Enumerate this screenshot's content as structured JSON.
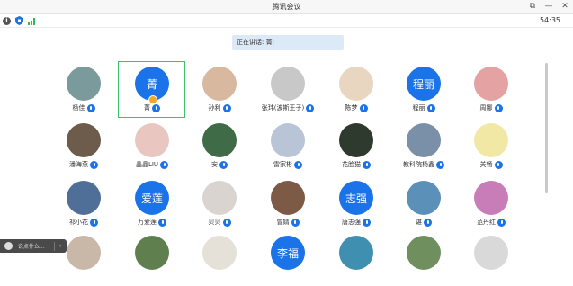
{
  "window": {
    "title": "腾讯会议"
  },
  "status": {
    "timer": "54:35"
  },
  "banner": {
    "text": "正在讲话: 菁;"
  },
  "participants": [
    {
      "name": "杨佳",
      "avatar_text": "",
      "color": "#7a9a9c"
    },
    {
      "name": "菁",
      "avatar_text": "菁",
      "color": "#1a73e8",
      "speaking": true
    },
    {
      "name": "孙利",
      "avatar_text": "",
      "color": "#d9b8a0"
    },
    {
      "name": "张玮(波斯王子)",
      "avatar_text": "",
      "color": "#c8c8c8"
    },
    {
      "name": "陈梦",
      "avatar_text": "",
      "color": "#e9d6c0"
    },
    {
      "name": "程丽",
      "avatar_text": "程丽",
      "color": "#1a73e8"
    },
    {
      "name": "周娜",
      "avatar_text": "",
      "color": "#e5a2a2"
    },
    {
      "name": "潘海燕",
      "avatar_text": "",
      "color": "#6d5b4b"
    },
    {
      "name": "晶晶LIU",
      "avatar_text": "",
      "color": "#e9c7c0"
    },
    {
      "name": "安",
      "avatar_text": "",
      "color": "#3f6b47"
    },
    {
      "name": "雷家彬",
      "avatar_text": "",
      "color": "#b9c5d6"
    },
    {
      "name": "花脸猫",
      "avatar_text": "",
      "color": "#2f3a2f"
    },
    {
      "name": "教科院杨鑫",
      "avatar_text": "",
      "color": "#7a8fa8"
    },
    {
      "name": "关畅",
      "avatar_text": "",
      "color": "#f2e8a6"
    },
    {
      "name": "祁小花",
      "avatar_text": "",
      "color": "#4f6f98"
    },
    {
      "name": "万爱莲",
      "avatar_text": "爱莲",
      "color": "#1a73e8"
    },
    {
      "name": "贝贝",
      "avatar_text": "",
      "color": "#d9d4cf"
    },
    {
      "name": "曾婧",
      "avatar_text": "",
      "color": "#7d5a45"
    },
    {
      "name": "唐志强",
      "avatar_text": "志强",
      "color": "#1a73e8"
    },
    {
      "name": "谌",
      "avatar_text": "",
      "color": "#5b90b8"
    },
    {
      "name": "范丹红",
      "avatar_text": "",
      "color": "#c87db8"
    },
    {
      "name": "",
      "avatar_text": "",
      "color": "#c9b8a8"
    },
    {
      "name": "",
      "avatar_text": "",
      "color": "#5f7f4f"
    },
    {
      "name": "",
      "avatar_text": "",
      "color": "#e5e0d8"
    },
    {
      "name": "",
      "avatar_text": "李福",
      "color": "#1a73e8"
    },
    {
      "name": "",
      "avatar_text": "",
      "color": "#3f8fb0"
    },
    {
      "name": "",
      "avatar_text": "",
      "color": "#6f8f5f"
    },
    {
      "name": "",
      "avatar_text": "",
      "color": "#d9d9d9"
    }
  ],
  "chat": {
    "placeholder": "说点什么..."
  }
}
